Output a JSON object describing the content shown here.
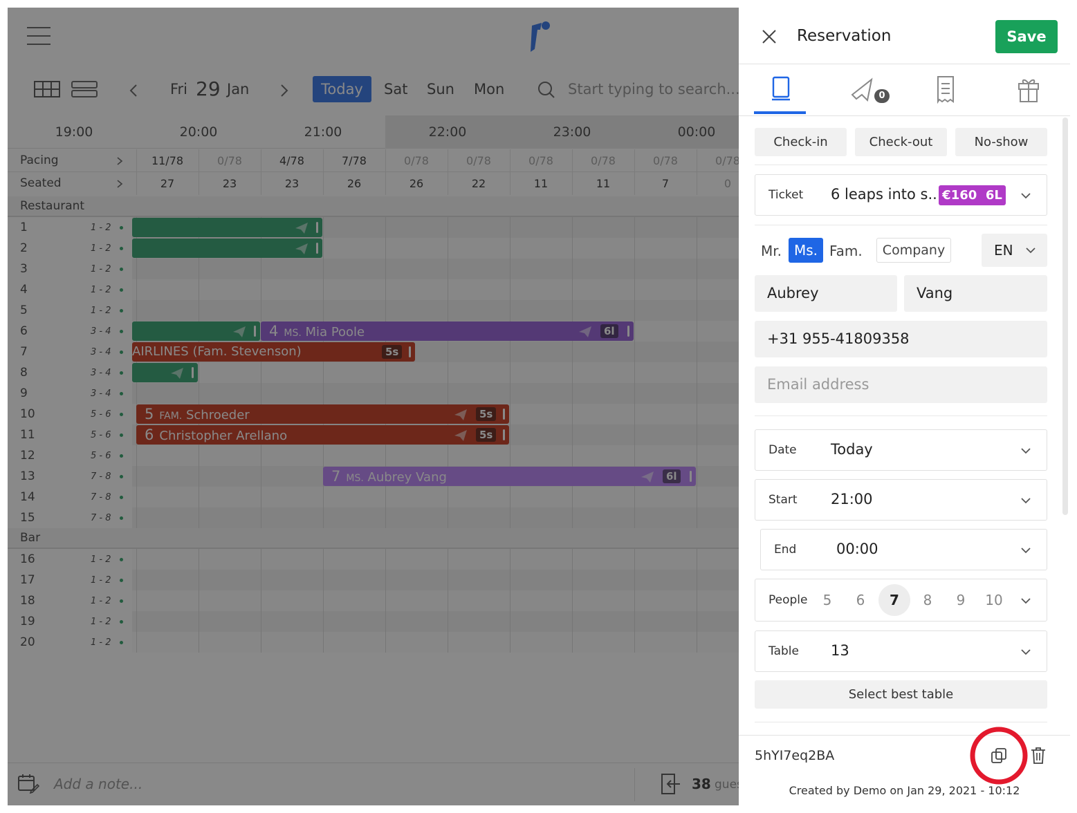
{
  "topbar": {
    "menu_icon": "hamburger-icon",
    "logo_icon": "brand-logo-icon"
  },
  "datenav": {
    "day": "Fri",
    "date": "29",
    "month": "Jan",
    "today": "Today",
    "next_days": [
      "Sat",
      "Sun",
      "Mon"
    ],
    "search_placeholder": "Start typing to search..."
  },
  "timeline": {
    "hours": [
      "19:00",
      "20:00",
      "21:00",
      "22:00",
      "23:00",
      "00:00"
    ],
    "pacing_label": "Pacing",
    "seated_label": "Seated",
    "pacing": [
      "11/78",
      "0/78",
      "4/78",
      "7/78",
      "0/78",
      "0/78",
      "0/78",
      "0/78",
      "0/78",
      "0/78"
    ],
    "seated": [
      "27",
      "23",
      "23",
      "26",
      "26",
      "22",
      "11",
      "11",
      "7",
      "0"
    ]
  },
  "sections": [
    {
      "name": "Restaurant",
      "tables": [
        {
          "num": "1",
          "cap": "1 - 2"
        },
        {
          "num": "2",
          "cap": "1 - 2"
        },
        {
          "num": "3",
          "cap": "1 - 2"
        },
        {
          "num": "4",
          "cap": "1 - 2"
        },
        {
          "num": "5",
          "cap": "1 - 2"
        },
        {
          "num": "6",
          "cap": "3 - 4"
        },
        {
          "num": "7",
          "cap": "3 - 4"
        },
        {
          "num": "8",
          "cap": "3 - 4"
        },
        {
          "num": "9",
          "cap": "3 - 4"
        },
        {
          "num": "10",
          "cap": "5 - 6"
        },
        {
          "num": "11",
          "cap": "5 - 6"
        },
        {
          "num": "12",
          "cap": "5 - 6"
        },
        {
          "num": "13",
          "cap": "7 - 8"
        },
        {
          "num": "14",
          "cap": "7 - 8"
        },
        {
          "num": "15",
          "cap": "7 - 8"
        }
      ]
    },
    {
      "name": "Bar",
      "tables": [
        {
          "num": "16",
          "cap": "1 - 2"
        },
        {
          "num": "17",
          "cap": "1 - 2"
        },
        {
          "num": "18",
          "cap": "1 - 2"
        },
        {
          "num": "19",
          "cap": "1 - 2"
        },
        {
          "num": "20",
          "cap": "1 - 2"
        }
      ]
    }
  ],
  "reservations": [
    {
      "id": "r7",
      "party": "",
      "title": "",
      "name": "AIRLINES (Fam. Stevenson)",
      "badge": "5s"
    },
    {
      "id": "r6b",
      "party": "4",
      "title": "MS.",
      "name": "Mia Poole",
      "badge": "6l"
    },
    {
      "id": "r10",
      "party": "5",
      "title": "FAM.",
      "name": "Schroeder",
      "badge": "5s"
    },
    {
      "id": "r11",
      "party": "6",
      "title": "",
      "name": "Christopher Arellano",
      "badge": "5s"
    },
    {
      "id": "r13",
      "party": "7",
      "title": "MS.",
      "name": "Aubrey Vang",
      "badge": "6l"
    }
  ],
  "bottombar": {
    "note_placeholder": "Add a note...",
    "guest_count": "38",
    "guest_label": "gues"
  },
  "panel": {
    "title": "Reservation",
    "save": "Save",
    "messages_count": "0",
    "actions": [
      "Check-in",
      "Check-out",
      "No-show"
    ],
    "ticket": {
      "label": "Ticket",
      "value": "6 leaps into s...",
      "price": "€160",
      "code": "6L"
    },
    "salutations": [
      "Mr.",
      "Ms.",
      "Fam."
    ],
    "selected_salutation": "Ms.",
    "company": "Company",
    "language": "EN",
    "first_name": "Aubrey",
    "last_name": "Vang",
    "phone": "+31 955-41809358",
    "email_placeholder": "Email address",
    "date": {
      "label": "Date",
      "value": "Today"
    },
    "start": {
      "label": "Start",
      "value": "21:00"
    },
    "end": {
      "label": "End",
      "value": "00:00"
    },
    "people": {
      "label": "People",
      "options": [
        "5",
        "6",
        "7",
        "8",
        "9",
        "10"
      ],
      "selected": "7"
    },
    "table": {
      "label": "Table",
      "value": "13"
    },
    "best_table": "Select best table",
    "code": "5hYI7eq2BA",
    "created": "Created by Demo on Jan 29, 2021 - 10:12"
  },
  "colors": {
    "accent": "#1f66e5",
    "save": "#19a15a",
    "green_bar": "#1f9a63",
    "red_bar": "#c0260a",
    "purple_bar": "#8a4fd3",
    "light_purple_bar": "#b277f5",
    "ticket_badge": "#b03ac7",
    "highlight_ring": "#e3192d"
  }
}
